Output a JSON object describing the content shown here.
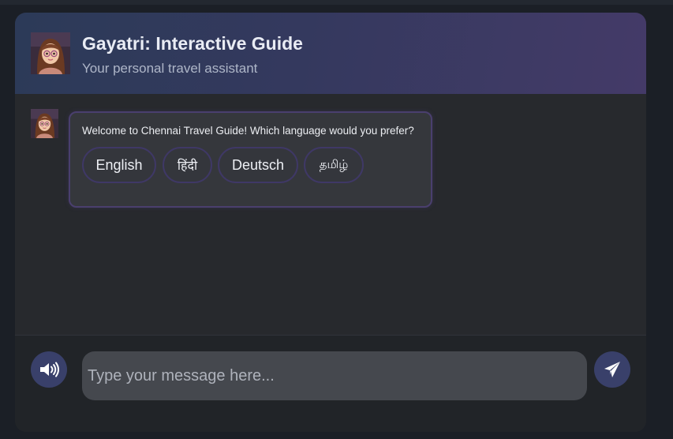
{
  "header": {
    "title": "Gayatri: Interactive Guide",
    "subtitle": "Your personal travel assistant",
    "avatar_icon": "assistant-avatar-icon"
  },
  "messages": [
    {
      "sender": "assistant",
      "text": "Welcome to Chennai Travel Guide! Which language would you prefer?",
      "options": [
        "English",
        "हिंदी",
        "Deutsch",
        "தமிழ்"
      ]
    }
  ],
  "input": {
    "placeholder": "Type your message here...",
    "value": ""
  },
  "controls": {
    "voice_icon": "speaker-volume-icon",
    "send_icon": "paper-plane-icon"
  },
  "colors": {
    "accent": "#39406a",
    "bubble_border": "#4a3f6e",
    "background": "#1b1f26"
  }
}
